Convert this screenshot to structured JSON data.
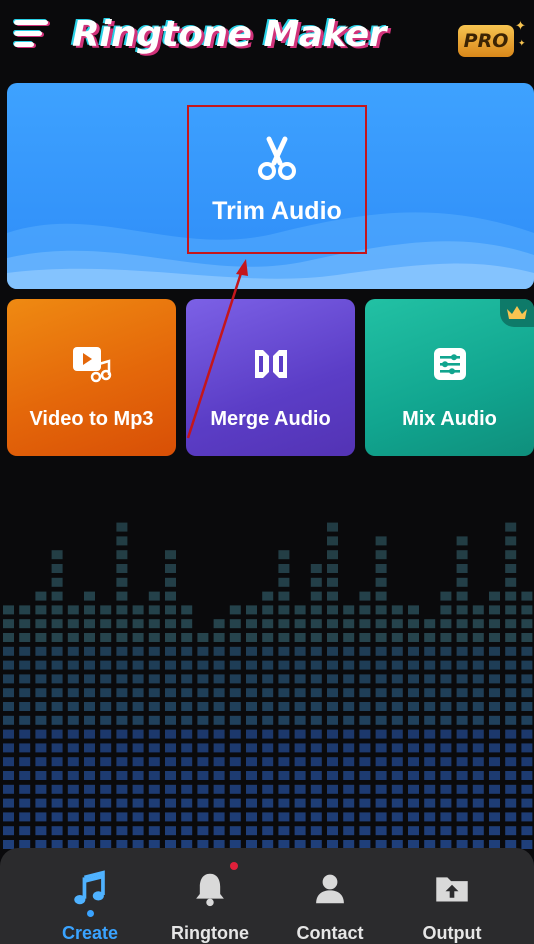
{
  "header": {
    "title": "Ringtone Maker",
    "pro_label": "PRO"
  },
  "main_action": {
    "label": "Trim Audio",
    "icon": "scissors-icon"
  },
  "features": [
    {
      "label": "Video to Mp3",
      "icon": "video-music-icon",
      "premium": false
    },
    {
      "label": "Merge Audio",
      "icon": "merge-icon",
      "premium": false
    },
    {
      "label": "Mix Audio",
      "icon": "sliders-icon",
      "premium": true
    }
  ],
  "bottom_nav": {
    "items": [
      {
        "label": "Create",
        "icon": "music-note-icon",
        "active": true
      },
      {
        "label": "Ringtone",
        "icon": "bell-icon",
        "notification": true
      },
      {
        "label": "Contact",
        "icon": "contact-icon"
      },
      {
        "label": "Output",
        "icon": "upload-folder-icon"
      }
    ]
  },
  "colors": {
    "trim_card": "#3ea2ff",
    "video_card": "#e4670a",
    "merge_card": "#5b3dc6",
    "mix_card": "#11a58f",
    "active_nav": "#3aa3ff",
    "annotation": "#c4161c"
  }
}
